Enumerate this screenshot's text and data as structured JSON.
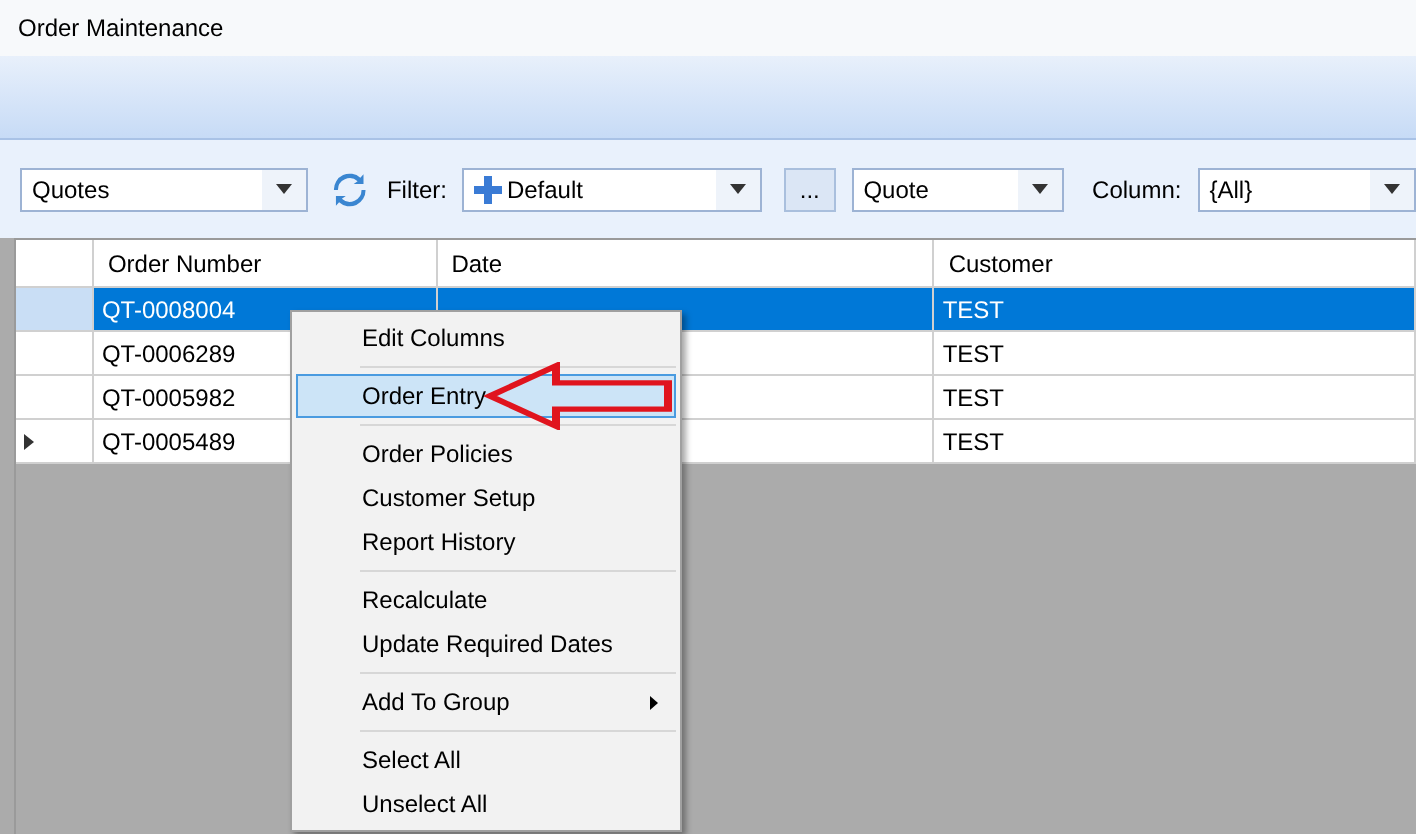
{
  "window": {
    "title": "Order Maintenance"
  },
  "toolbar": {
    "view": {
      "value": "Quotes"
    },
    "filter_label": "Filter:",
    "filter": {
      "value": "Default"
    },
    "more_button": "...",
    "type": {
      "value": "Quote"
    },
    "column_label": "Column:",
    "column": {
      "value": "{All}"
    }
  },
  "table": {
    "columns": [
      "Order Number",
      "Date",
      "Customer"
    ],
    "rows": [
      {
        "cells": [
          "QT-0008004",
          "",
          "TEST"
        ],
        "selected": true,
        "current": false
      },
      {
        "cells": [
          "QT-0006289",
          "",
          "TEST"
        ],
        "selected": false,
        "current": false
      },
      {
        "cells": [
          "QT-0005982",
          "",
          "TEST"
        ],
        "selected": false,
        "current": false
      },
      {
        "cells": [
          "QT-0005489",
          "",
          "TEST"
        ],
        "selected": false,
        "current": true
      }
    ]
  },
  "context_menu": {
    "groups": [
      [
        {
          "label": "Edit Columns",
          "selected": false,
          "submenu": false
        }
      ],
      [
        {
          "label": "Order Entry",
          "selected": true,
          "submenu": false
        }
      ],
      [
        {
          "label": "Order Policies",
          "selected": false,
          "submenu": false
        },
        {
          "label": "Customer Setup",
          "selected": false,
          "submenu": false
        },
        {
          "label": "Report History",
          "selected": false,
          "submenu": false
        }
      ],
      [
        {
          "label": "Recalculate",
          "selected": false,
          "submenu": false
        },
        {
          "label": "Update Required Dates",
          "selected": false,
          "submenu": false
        }
      ],
      [
        {
          "label": "Add To Group",
          "selected": false,
          "submenu": true
        }
      ],
      [
        {
          "label": "Select All",
          "selected": false,
          "submenu": false
        },
        {
          "label": "Unselect All",
          "selected": false,
          "submenu": false
        }
      ]
    ]
  }
}
